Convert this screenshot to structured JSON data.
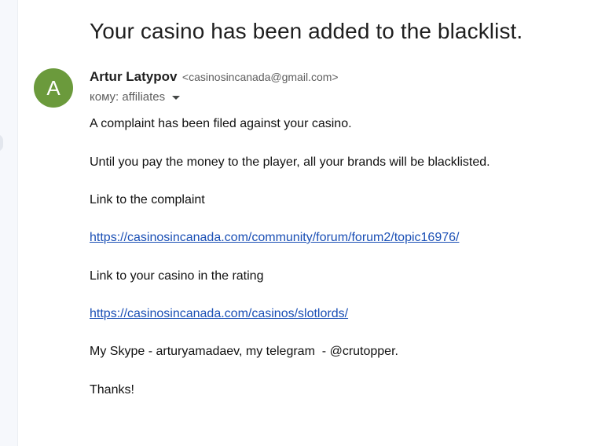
{
  "email": {
    "subject": "Your casino has been added to the blacklist.",
    "sender": {
      "avatar_letter": "A",
      "name": "Artur Latypov",
      "email": "<casinosincanada@gmail.com>"
    },
    "recipient_label": "кому: affiliates",
    "body": {
      "line1": "A complaint has been filed against your casino.",
      "line2": "Until you pay the money to the player, all your brands will be blacklisted.",
      "line3": "Link to the complaint",
      "link1": "https://casinosincanada.com/community/forum/forum2/topic16976/",
      "line4": "Link to your casino in the rating",
      "link2": "https://casinosincanada.com/casinos/slotlords/",
      "line5": "My Skype - arturyamadaev, my telegram  - @crutopper.",
      "line6": "Thanks!"
    }
  },
  "colors": {
    "avatar": "#6b9a3c",
    "link": "#1a4fb5"
  },
  "icons": {
    "recipient_toggle": "chevron-down-icon"
  }
}
